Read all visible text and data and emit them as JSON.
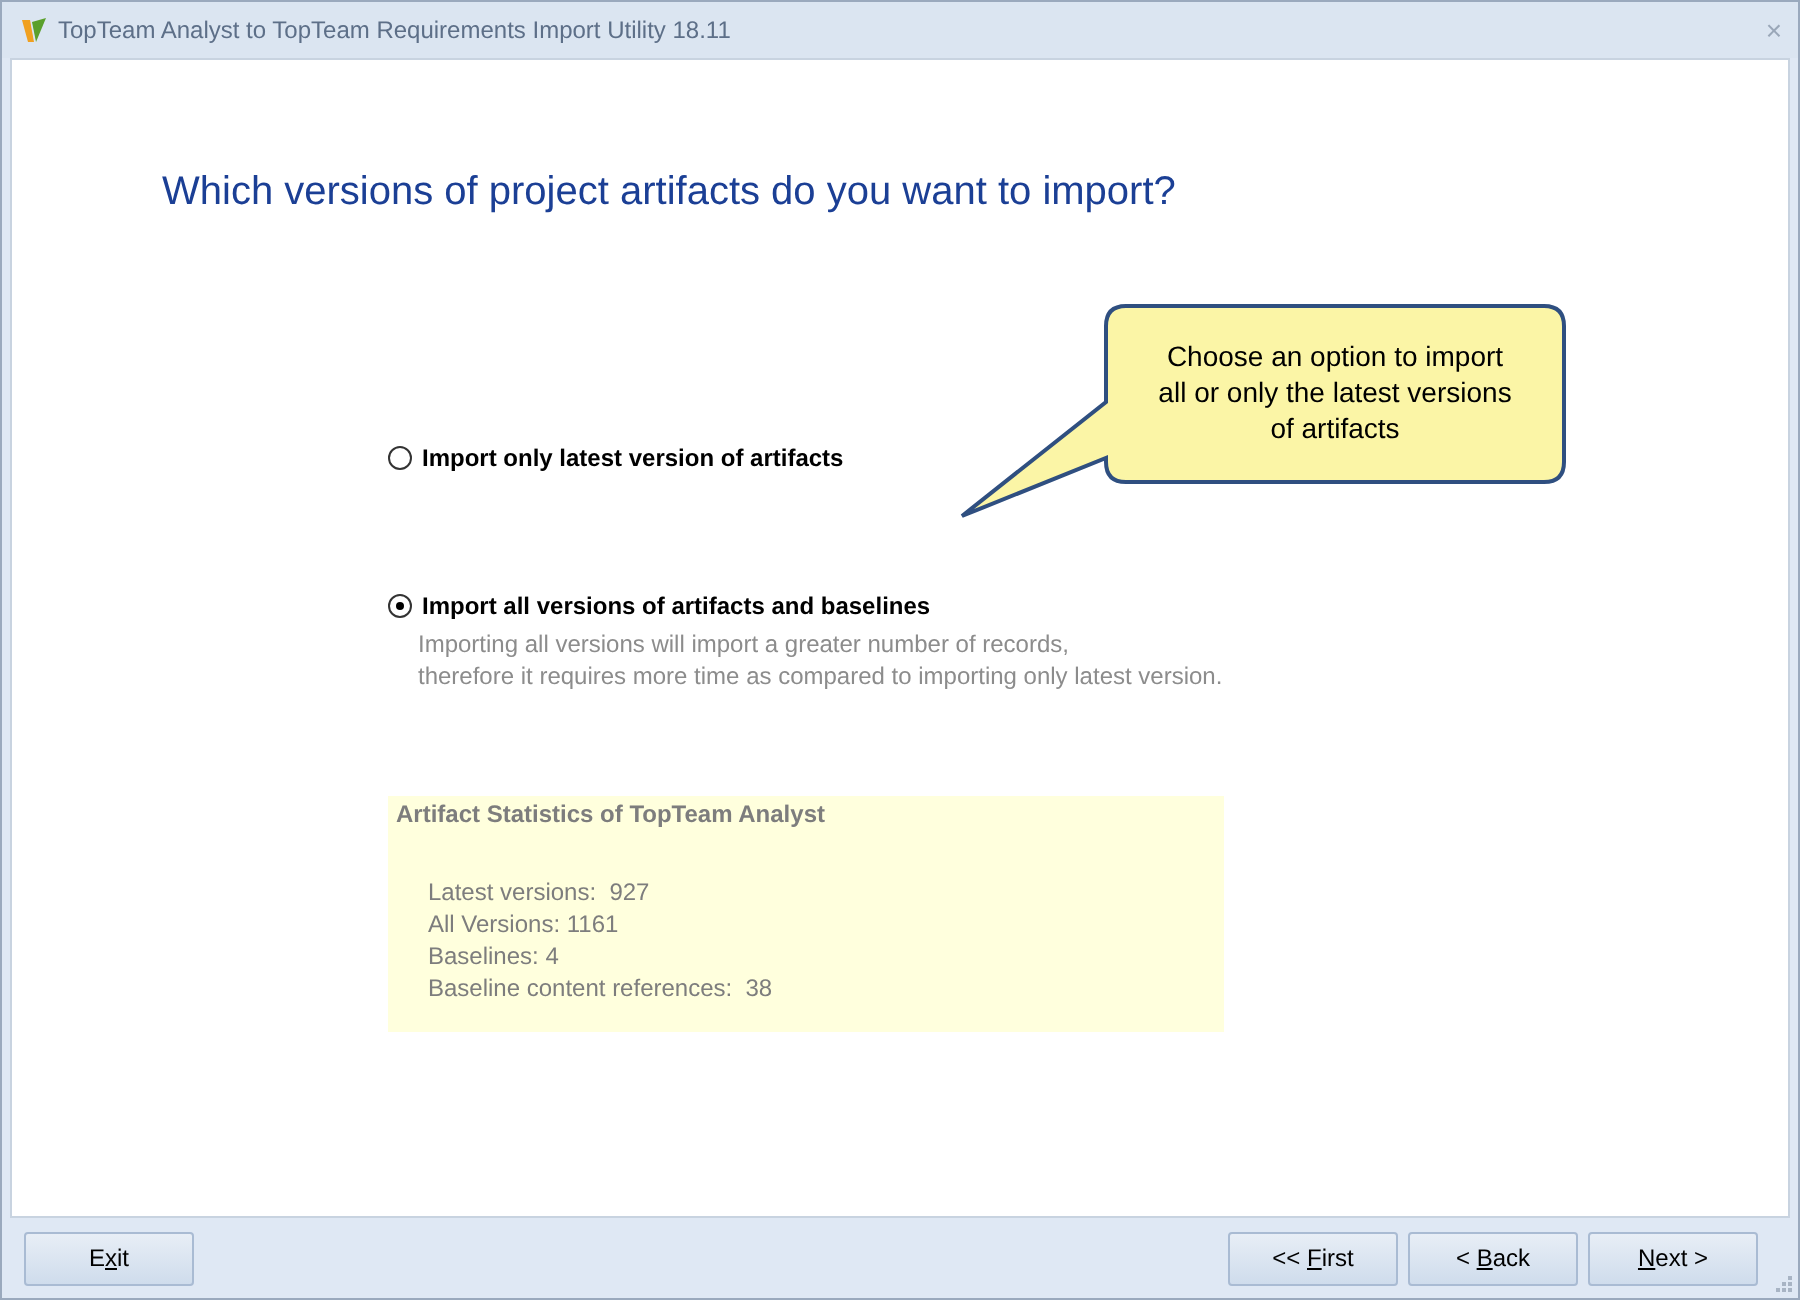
{
  "window": {
    "title": "TopTeam Analyst to TopTeam Requirements Import Utility 18.11",
    "close": "×"
  },
  "heading": "Which versions of project artifacts do you want to import?",
  "callout": {
    "lines": [
      "Choose an option to import",
      "all or only the latest versions",
      "of artifacts"
    ]
  },
  "options": [
    {
      "label": "Import only latest version of artifacts",
      "selected": false
    },
    {
      "label": "Import all versions of artifacts and baselines",
      "selected": true,
      "description": [
        "Importing all versions will import a greater number of records,",
        "therefore it requires more time as compared to importing only latest version."
      ]
    }
  ],
  "statistics": {
    "title": "Artifact Statistics of TopTeam Analyst",
    "lines": [
      "Latest versions:  927",
      "All Versions: 1161",
      "Baselines: 4",
      "Baseline content references:  38"
    ]
  },
  "buttons_left": [
    {
      "before": "E",
      "key": "x",
      "after": "it"
    }
  ],
  "buttons_right": [
    {
      "before": "<< ",
      "key": "F",
      "after": "irst"
    },
    {
      "before": "< ",
      "key": "B",
      "after": "ack"
    },
    {
      "key": "N",
      "after": "ext >"
    }
  ]
}
